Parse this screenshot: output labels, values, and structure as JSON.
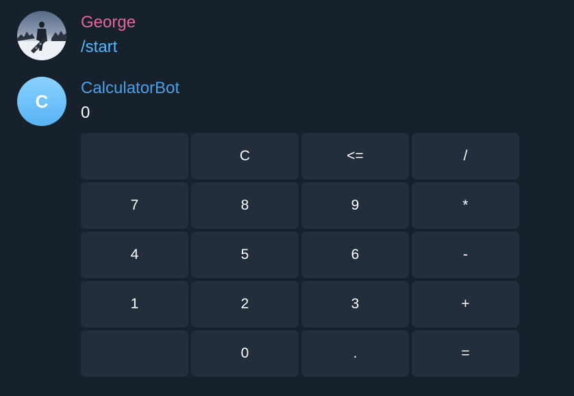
{
  "colors": {
    "background": "#17212b",
    "user_name": "#e3669f",
    "bot_name": "#4aa0e8",
    "command_link": "#52b8ff",
    "key_background": "#232e3c",
    "message_text": "#ffffff"
  },
  "messages": [
    {
      "sender": "George",
      "avatar": "photo",
      "text": "/start"
    },
    {
      "sender": "CalculatorBot",
      "avatar_letter": "C",
      "text": "0"
    }
  ],
  "keyboard": {
    "rows": [
      [
        "",
        "C",
        "<=",
        "/"
      ],
      [
        "7",
        "8",
        "9",
        "*"
      ],
      [
        "4",
        "5",
        "6",
        "-"
      ],
      [
        "1",
        "2",
        "3",
        "+"
      ],
      [
        "",
        "0",
        ".",
        "="
      ]
    ]
  }
}
